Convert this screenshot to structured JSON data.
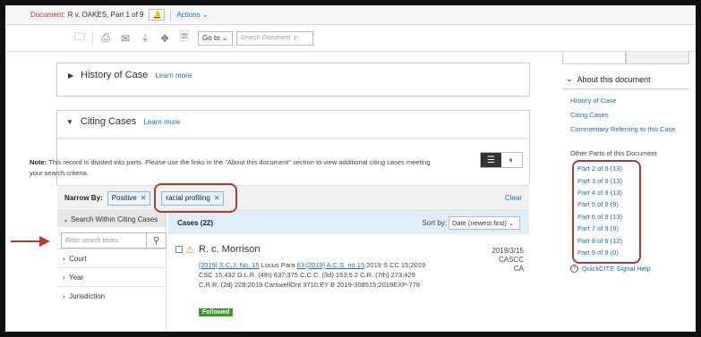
{
  "topbar": {
    "document_label": "Document:",
    "document_name": "R v. OAKES, Part 1 of 9",
    "actions_label": "Actions"
  },
  "toolbar": {
    "goto_label": "Go to",
    "search_placeholder": "Search Document"
  },
  "history": {
    "title": "History of Case",
    "learn_more": "Learn more"
  },
  "citing": {
    "title": "Citing Cases",
    "learn_more": "Learn more",
    "note_label": "Note:",
    "note_text": "This record is divided into parts. Please use the links in the \"About this document\" section to view additional citing cases meeting your search criteria."
  },
  "narrow": {
    "label": "Narrow By:",
    "chips": [
      "Positive",
      "racial profiling"
    ],
    "clear_label": "Clear"
  },
  "filters": {
    "header": "Search Within Citing Cases",
    "placeholder": "Enter search terms",
    "facets": [
      "Court",
      "Year",
      "Jurisdiction"
    ]
  },
  "results": {
    "count_label": "Cases (22)",
    "sort_label": "Sort by:",
    "sort_value": "Date (newest first)",
    "items": [
      {
        "title": "R. c. Morrison",
        "date": "2019/3/15",
        "court": "CASCC",
        "jurisdiction": "CA",
        "cite_link_1": "[2019] S.C.J. No. 15",
        "cite_mid": " Locus Para ",
        "cite_link_2": "63",
        "cite_link_3": ":[2019] A.C.S. no 15",
        "cite_rest": ";2019 S CC 15;2019 CSC 15;432 D.L.R. (4th) 637;375 C.C.C. (3d) 153;5 2 C.R. (7th) 273;429 C.R.R. (2d) 228;2019 CarswellOnt 3710;EY B 2019-308515;2019EXP-778",
        "treatment": "Followed"
      }
    ]
  },
  "sidebar": {
    "heading": "About this document",
    "links": [
      "History of Case",
      "Citing Cases",
      "Commentary Referring to this Case"
    ],
    "other_parts_label": "Other Parts of this Document",
    "parts": [
      "Part 2 of 9 (13)",
      "Part 3 of 9 (13)",
      "Part 4 of 9 (13)",
      "Part 5 of 9 (9)",
      "Part 6 of 9 (13)",
      "Part 7 of 9 (9)",
      "Part 8 of 9 (12)",
      "Part 9 of 9 (0)"
    ],
    "quickcite": "QuickCITE Signal Help"
  },
  "colors": {
    "accent": "#1a6dbb",
    "annotation": "#b23a2e",
    "followed": "#3c9a2a",
    "warning": "#e08a1e"
  }
}
